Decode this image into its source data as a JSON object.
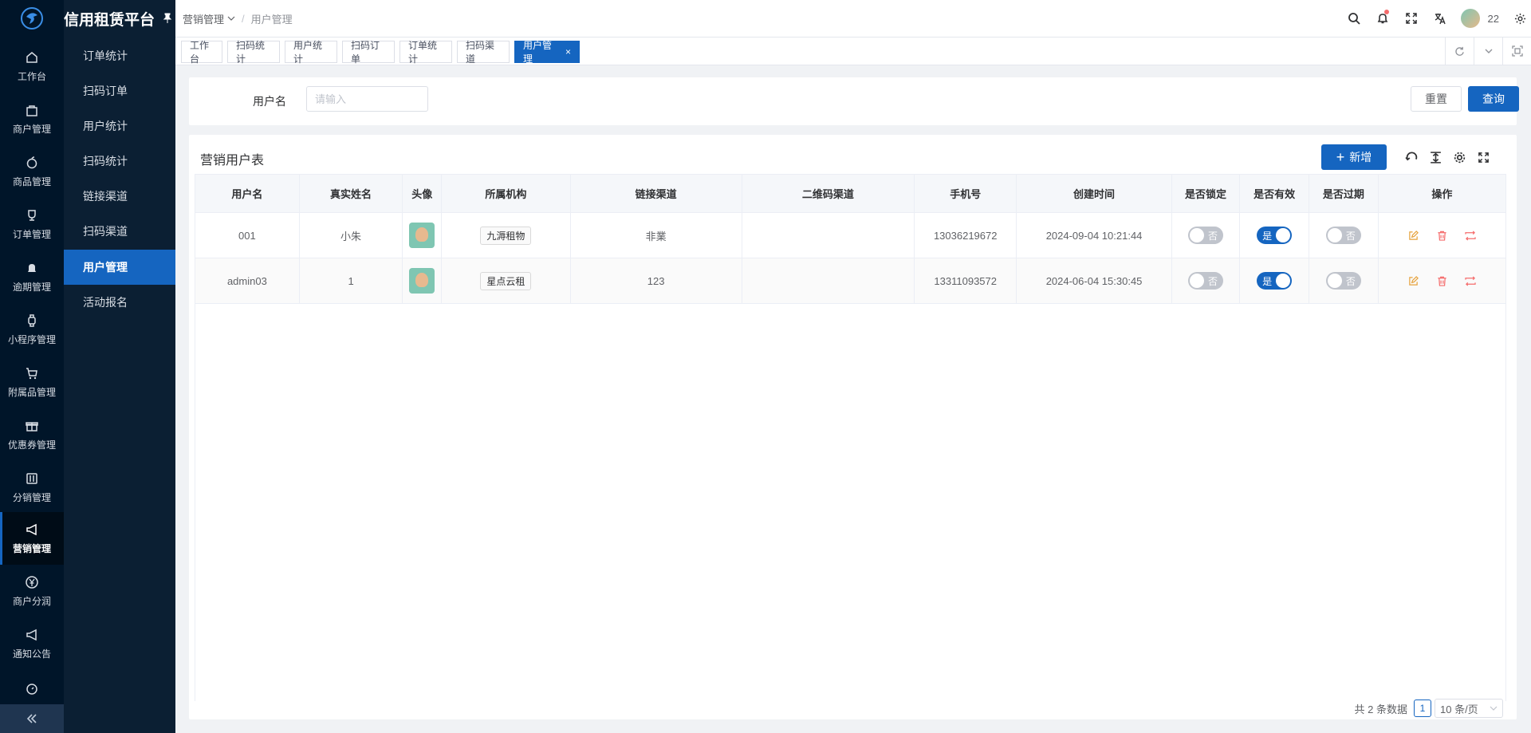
{
  "app": {
    "title": "信用租赁平台"
  },
  "side_nav": {
    "items": [
      {
        "label": "工作台",
        "icon": "home-icon"
      },
      {
        "label": "商户管理",
        "icon": "bag-icon"
      },
      {
        "label": "商品管理",
        "icon": "apple-icon"
      },
      {
        "label": "订单管理",
        "icon": "trophy-icon"
      },
      {
        "label": "逾期管理",
        "icon": "bell-icon"
      },
      {
        "label": "小程序管理",
        "icon": "watch-icon"
      },
      {
        "label": "附属品管理",
        "icon": "cart-icon"
      },
      {
        "label": "优惠券管理",
        "icon": "gift-icon"
      },
      {
        "label": "分销管理",
        "icon": "sliders-icon"
      },
      {
        "label": "营销管理",
        "icon": "megaphone-icon"
      },
      {
        "label": "商户分润",
        "icon": "yen-icon"
      },
      {
        "label": "通知公告",
        "icon": "megaphone-icon"
      }
    ],
    "active": "营销管理"
  },
  "sub_nav": {
    "items": [
      "订单统计",
      "扫码订单",
      "用户统计",
      "扫码统计",
      "链接渠道",
      "扫码渠道",
      "用户管理",
      "活动报名"
    ],
    "active": "用户管理"
  },
  "header": {
    "breadcrumb": [
      "营销管理",
      "用户管理"
    ],
    "username": "22"
  },
  "tabs": [
    "工作台",
    "扫码统计",
    "用户统计",
    "扫码订单",
    "订单统计",
    "扫码渠道",
    "用户管理"
  ],
  "active_tab": "用户管理",
  "search": {
    "label": "用户名",
    "placeholder": "请输入",
    "value": "",
    "reset_label": "重置",
    "query_label": "查询"
  },
  "table_card": {
    "title": "营销用户表",
    "add_label": "新增",
    "columns": [
      "用户名",
      "真实姓名",
      "头像",
      "所属机构",
      "链接渠道",
      "二维码渠道",
      "手机号",
      "创建时间",
      "是否锁定",
      "是否有效",
      "是否过期",
      "操作"
    ],
    "rows": [
      {
        "username": "001",
        "real_name": "小朱",
        "org": "九溽租物",
        "link_channel": "非業",
        "qr_channel": "",
        "phone": "13036219672",
        "created": "2024-09-04 10:21:44",
        "locked": "否",
        "valid": "是",
        "expired": "否"
      },
      {
        "username": "admin03",
        "real_name": "1",
        "org": "星点云租",
        "link_channel": "123",
        "qr_channel": "",
        "phone": "13311093572",
        "created": "2024-06-04 15:30:45",
        "locked": "否",
        "valid": "是",
        "expired": "否"
      }
    ]
  },
  "pagination": {
    "total_text": "共 2 条数据",
    "current_page": "1",
    "page_size": "10 条/页"
  },
  "colors": {
    "primary": "#1565c0",
    "sidebar": "#001529",
    "danger": "#f56c6c",
    "warning": "#e6a23c"
  }
}
